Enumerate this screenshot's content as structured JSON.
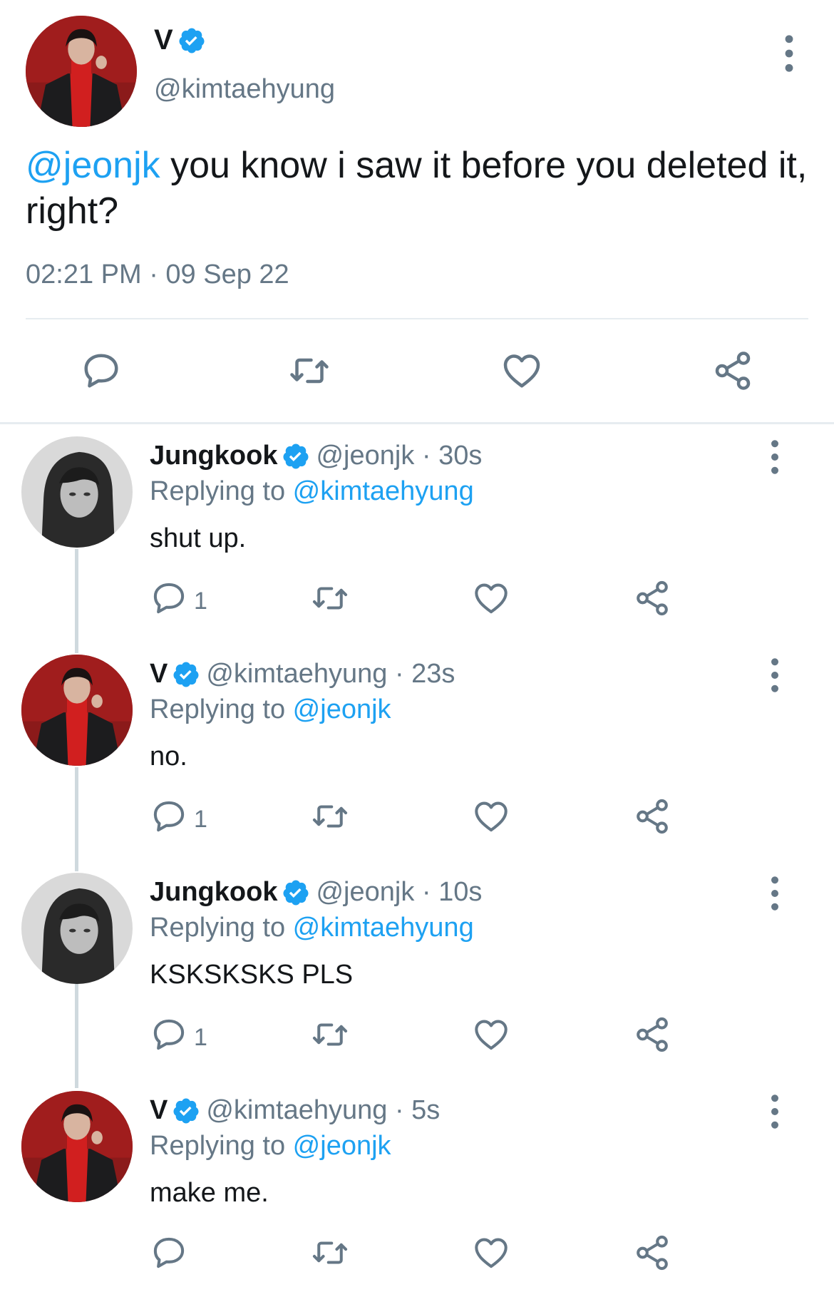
{
  "main_tweet": {
    "author_name": "V",
    "author_handle": "@kimtaehyung",
    "mention": "@jeonjk",
    "text": " you know i saw it before you deleted it, right?",
    "timestamp": "02:21 PM · 09 Sep 22"
  },
  "replies": [
    {
      "author_name": "Jungkook",
      "handle_time": "@jeonjk · 30s",
      "replying_prefix": "Replying to ",
      "replying_to": "@kimtaehyung",
      "text": "shut up.",
      "reply_count": "1"
    },
    {
      "author_name": "V",
      "handle_time": "@kimtaehyung · 23s",
      "replying_prefix": "Replying to ",
      "replying_to": "@jeonjk",
      "text": "no.",
      "reply_count": "1"
    },
    {
      "author_name": "Jungkook",
      "handle_time": "@jeonjk · 10s",
      "replying_prefix": "Replying to ",
      "replying_to": "@kimtaehyung",
      "text": "KSKSKSKS PLS",
      "reply_count": "1"
    },
    {
      "author_name": "V",
      "handle_time": "@kimtaehyung · 5s",
      "replying_prefix": "Replying to ",
      "replying_to": "@jeonjk",
      "text": "make me.",
      "reply_count": ""
    }
  ],
  "icons": {
    "verified": "verified-badge-icon",
    "reply": "reply-bubble-icon",
    "retweet": "retweet-icon",
    "like": "heart-icon",
    "share": "share-icon",
    "more": "more-vertical-icon"
  },
  "colors": {
    "accent": "#1da1f2",
    "secondary_text": "#657786",
    "primary_text": "#14171a",
    "divider": "#e6ecf0"
  }
}
